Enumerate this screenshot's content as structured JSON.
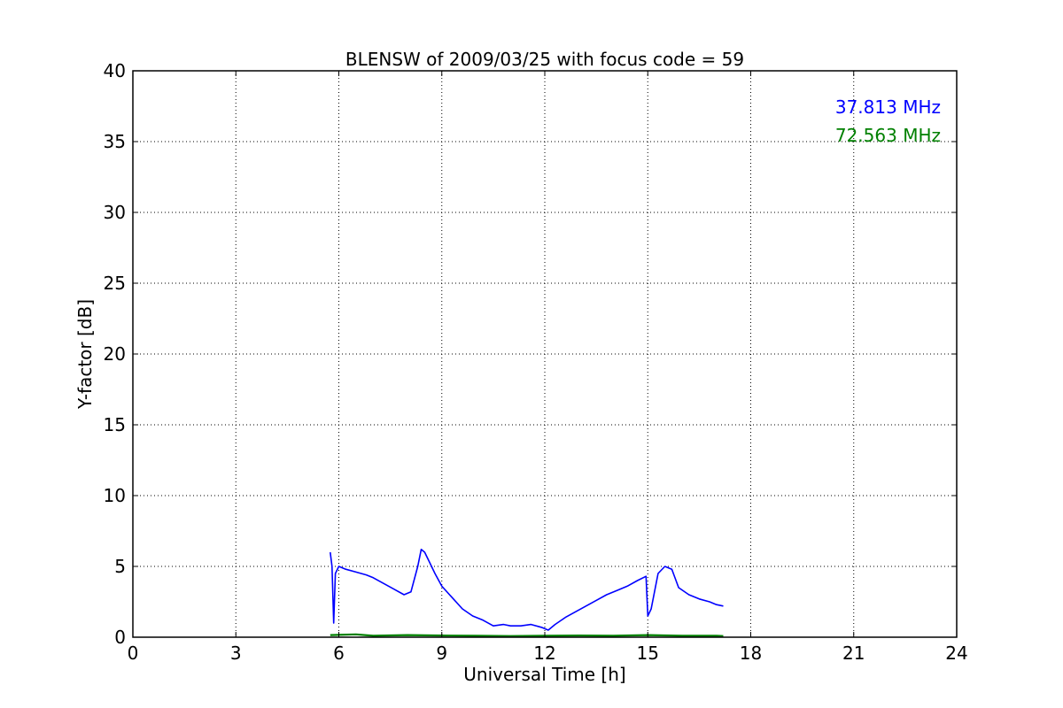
{
  "chart_data": {
    "type": "line",
    "title": "BLENSW of 2009/03/25 with focus code = 59",
    "xlabel": "Universal Time [h]",
    "ylabel": "Y-factor [dB]",
    "xlim": [
      0,
      24
    ],
    "ylim": [
      0,
      40
    ],
    "xticks": [
      0,
      3,
      6,
      9,
      12,
      15,
      18,
      21,
      24
    ],
    "yticks": [
      0,
      5,
      10,
      15,
      20,
      25,
      30,
      35,
      40
    ],
    "grid": true,
    "legend_position": "top-right",
    "series": [
      {
        "name": "37.813 MHz",
        "color": "#0000ff",
        "x": [
          5.75,
          5.8,
          5.85,
          5.9,
          6.0,
          6.2,
          6.5,
          6.8,
          7.0,
          7.3,
          7.6,
          7.9,
          8.1,
          8.3,
          8.4,
          8.5,
          8.6,
          8.8,
          9.0,
          9.3,
          9.6,
          9.9,
          10.2,
          10.5,
          10.8,
          11.0,
          11.3,
          11.6,
          11.9,
          12.1,
          12.3,
          12.6,
          12.9,
          13.2,
          13.5,
          13.8,
          14.1,
          14.4,
          14.7,
          14.95,
          15.0,
          15.1,
          15.3,
          15.5,
          15.7,
          15.9,
          16.2,
          16.5,
          16.8,
          17.0,
          17.2
        ],
        "values": [
          6.0,
          5.0,
          1.0,
          4.5,
          5.0,
          4.8,
          4.6,
          4.4,
          4.2,
          3.8,
          3.4,
          3.0,
          3.2,
          5.0,
          6.2,
          6.0,
          5.5,
          4.5,
          3.6,
          2.8,
          2.0,
          1.5,
          1.2,
          0.8,
          0.9,
          0.8,
          0.8,
          0.9,
          0.7,
          0.5,
          0.9,
          1.4,
          1.8,
          2.2,
          2.6,
          3.0,
          3.3,
          3.6,
          4.0,
          4.3,
          1.5,
          2.0,
          4.5,
          5.0,
          4.8,
          3.5,
          3.0,
          2.7,
          2.5,
          2.3,
          2.2
        ]
      },
      {
        "name": "72.563 MHz",
        "color": "#008000",
        "x": [
          5.75,
          6.5,
          7.0,
          8.0,
          9.0,
          10.0,
          11.0,
          12.0,
          13.0,
          14.0,
          15.0,
          16.0,
          17.0,
          17.2
        ],
        "values": [
          0.15,
          0.2,
          0.1,
          0.15,
          0.12,
          0.1,
          0.08,
          0.1,
          0.12,
          0.1,
          0.15,
          0.1,
          0.1,
          0.08
        ]
      }
    ]
  }
}
